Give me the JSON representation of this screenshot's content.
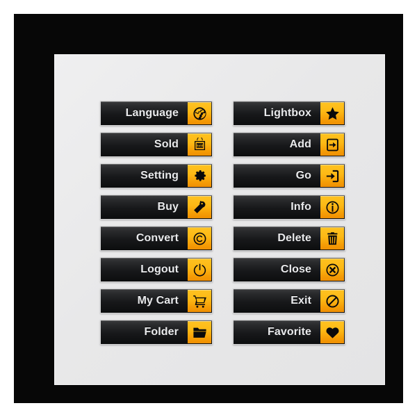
{
  "theme": {
    "page_background": "#ffffff",
    "frame_color": "#070707",
    "panel_color": "#eaeaeb",
    "button_dark": "#17181a",
    "accent_orange": "#fdb915",
    "accent_orange_dark": "#ef8f02",
    "label_color": "#e9eaec",
    "icon_color": "#0a0a0a"
  },
  "buttons": {
    "left_column": [
      {
        "label": "Language",
        "icon": "globe-icon"
      },
      {
        "label": "Sold",
        "icon": "sold-bag-icon"
      },
      {
        "label": "Setting",
        "icon": "gear-icon"
      },
      {
        "label": "Buy",
        "icon": "price-tag-icon"
      },
      {
        "label": "Convert",
        "icon": "copyright-icon"
      },
      {
        "label": "Logout",
        "icon": "power-icon"
      },
      {
        "label": "My Cart",
        "icon": "shopping-cart-icon"
      },
      {
        "label": "Folder",
        "icon": "folder-open-icon"
      }
    ],
    "right_column": [
      {
        "label": "Lightbox",
        "icon": "star-icon"
      },
      {
        "label": "Add",
        "icon": "arrow-into-box-icon"
      },
      {
        "label": "Go",
        "icon": "arrow-enter-icon"
      },
      {
        "label": "Info",
        "icon": "info-circle-icon"
      },
      {
        "label": "Delete",
        "icon": "trash-can-icon"
      },
      {
        "label": "Close",
        "icon": "close-circle-icon"
      },
      {
        "label": "Exit",
        "icon": "prohibition-icon"
      },
      {
        "label": "Favorite",
        "icon": "heart-icon"
      }
    ]
  }
}
